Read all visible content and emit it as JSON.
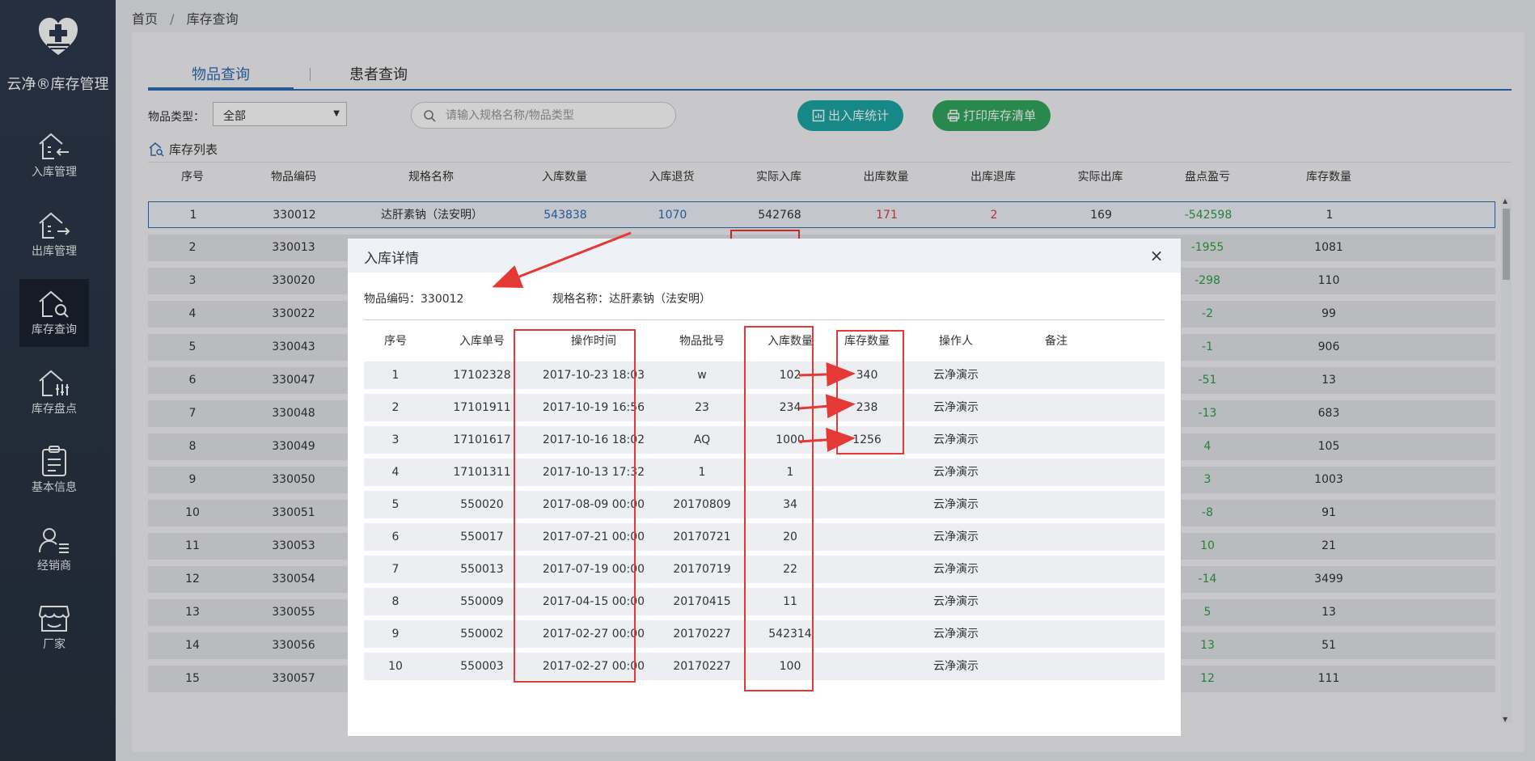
{
  "sidebar": {
    "brand": "云净®库存管理",
    "items": [
      {
        "label": "入库管理",
        "icon": "inbound-house-icon"
      },
      {
        "label": "出库管理",
        "icon": "outbound-house-icon"
      },
      {
        "label": "库存查询",
        "icon": "inventory-search-icon"
      },
      {
        "label": "库存盘点",
        "icon": "stocktake-icon"
      },
      {
        "label": "基本信息",
        "icon": "clipboard-icon"
      },
      {
        "label": "经销商",
        "icon": "user-list-icon"
      },
      {
        "label": "厂家",
        "icon": "store-icon"
      }
    ]
  },
  "breadcrumb": {
    "home": "首页",
    "sep": "/",
    "current": "库存查询"
  },
  "tabs": [
    {
      "label": "物品查询"
    },
    {
      "label": "患者查询"
    }
  ],
  "filter": {
    "type_label": "物品类型：",
    "type_value": "全部"
  },
  "search": {
    "placeholder": "请输入规格名称/物品类型"
  },
  "buttons": {
    "stats": "出入库统计",
    "print": "打印库存清单"
  },
  "list_title": "库存列表",
  "table": {
    "headers": [
      "序号",
      "物品编码",
      "规格名称",
      "入库数量",
      "入库退货",
      "实际入库",
      "出库数量",
      "出库退库",
      "实际出库",
      "盘点盈亏",
      "库存数量"
    ],
    "rows": [
      {
        "no": "1",
        "code": "330012",
        "name": "达肝素钠（法安明）",
        "in_qty": "543838",
        "in_return": "1070",
        "actual_in": "542768",
        "out_qty": "171",
        "out_return": "2",
        "actual_out": "169",
        "diff": "-542598",
        "stock": "1"
      },
      {
        "no": "2",
        "code": "330013",
        "diff": "-1955",
        "stock": "1081"
      },
      {
        "no": "3",
        "code": "330020",
        "diff": "-298",
        "stock": "110"
      },
      {
        "no": "4",
        "code": "330022",
        "diff": "-2",
        "stock": "99"
      },
      {
        "no": "5",
        "code": "330043",
        "diff": "-1",
        "stock": "906"
      },
      {
        "no": "6",
        "code": "330047",
        "diff": "-51",
        "stock": "13"
      },
      {
        "no": "7",
        "code": "330048",
        "diff": "-13",
        "stock": "683"
      },
      {
        "no": "8",
        "code": "330049",
        "diff": "4",
        "stock": "105"
      },
      {
        "no": "9",
        "code": "330050",
        "diff": "3",
        "stock": "1003"
      },
      {
        "no": "10",
        "code": "330051",
        "diff": "-8",
        "stock": "91"
      },
      {
        "no": "11",
        "code": "330053",
        "diff": "10",
        "stock": "21"
      },
      {
        "no": "12",
        "code": "330054",
        "diff": "-14",
        "stock": "3499"
      },
      {
        "no": "13",
        "code": "330055",
        "diff": "5",
        "stock": "13"
      },
      {
        "no": "14",
        "code": "330056",
        "diff": "13",
        "stock": "51"
      },
      {
        "no": "15",
        "code": "330057",
        "diff": "12",
        "stock": "111"
      }
    ]
  },
  "modal": {
    "title": "入库详情",
    "close": "×",
    "code_label": "物品编码：330012",
    "name_label": "规格名称：达肝素钠（法安明）",
    "headers": [
      "序号",
      "入库单号",
      "操作时间",
      "物品批号",
      "入库数量",
      "库存数量",
      "操作人",
      "备注"
    ],
    "rows": [
      {
        "no": "1",
        "order": "17102328",
        "time": "2017-10-23 18:03",
        "batch": "w",
        "qty": "102",
        "stock": "340",
        "op": "云净演示",
        "note": ""
      },
      {
        "no": "2",
        "order": "17101911",
        "time": "2017-10-19 16:56",
        "batch": "23",
        "qty": "234",
        "stock": "238",
        "op": "云净演示",
        "note": ""
      },
      {
        "no": "3",
        "order": "17101617",
        "time": "2017-10-16 18:02",
        "batch": "AQ",
        "qty": "1000",
        "stock": "1256",
        "op": "云净演示",
        "note": ""
      },
      {
        "no": "4",
        "order": "17101311",
        "time": "2017-10-13 17:32",
        "batch": "1",
        "qty": "1",
        "stock": "",
        "op": "云净演示",
        "note": ""
      },
      {
        "no": "5",
        "order": "550020",
        "time": "2017-08-09 00:00",
        "batch": "20170809",
        "qty": "34",
        "stock": "",
        "op": "云净演示",
        "note": ""
      },
      {
        "no": "6",
        "order": "550017",
        "time": "2017-07-21 00:00",
        "batch": "20170721",
        "qty": "20",
        "stock": "",
        "op": "云净演示",
        "note": ""
      },
      {
        "no": "7",
        "order": "550013",
        "time": "2017-07-19 00:00",
        "batch": "20170719",
        "qty": "22",
        "stock": "",
        "op": "云净演示",
        "note": ""
      },
      {
        "no": "8",
        "order": "550009",
        "time": "2017-04-15 00:00",
        "batch": "20170415",
        "qty": "11",
        "stock": "",
        "op": "云净演示",
        "note": ""
      },
      {
        "no": "9",
        "order": "550002",
        "time": "2017-02-27 00:00",
        "batch": "20170227",
        "qty": "542314",
        "stock": "",
        "op": "云净演示",
        "note": ""
      },
      {
        "no": "10",
        "order": "550003",
        "time": "2017-02-27 00:00",
        "batch": "20170227",
        "qty": "100",
        "stock": "",
        "op": "云净演示",
        "note": ""
      }
    ]
  },
  "colors": {
    "sidebar": "#2e3a4d",
    "accent": "#2f6cb5",
    "teal": "#1aa6a5",
    "green": "#31a75e",
    "annotation": "#e53935"
  }
}
